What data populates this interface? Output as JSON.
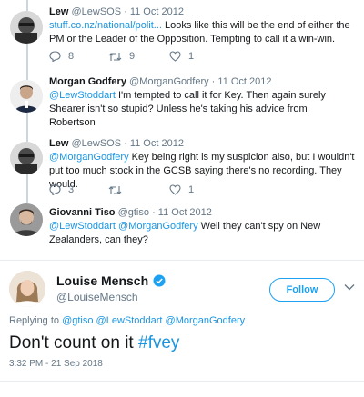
{
  "tweets": [
    {
      "name": "Lew",
      "handle": "@LewSOS",
      "date": "· 11 Oct 2012",
      "link": "stuff.co.nz/national/polit...",
      "text": " Looks like this will be the end of either the PM or the Leader of the Opposition. Tempting to call it a win-win.",
      "replies": "8",
      "retweets": "9",
      "likes": "1"
    },
    {
      "name": "Morgan Godfery",
      "handle": "@MorganGodfery",
      "date": "· 11 Oct 2012",
      "mention": "@LewStoddart",
      "text": " I'm tempted to call it for Key. Then again surely Shearer isn't so stupid? Unless he's taking his advice from Robertson"
    },
    {
      "name": "Lew",
      "handle": "@LewSOS",
      "date": "· 11 Oct 2012",
      "mention": "@MorganGodfery",
      "text": " Key being right is my suspicion also, but I wouldn't put too much stock in the GCSB saying there's no recording. They would.",
      "replies": "3",
      "retweets": "",
      "likes": "1"
    },
    {
      "name": "Giovanni Tiso",
      "handle": "@gtiso",
      "date": "· 11 Oct 2012",
      "mention1": "@LewStoddart",
      "mention2": "@MorganGodfery",
      "text": " Well they can't spy on New Zealanders, can they?"
    }
  ],
  "main_tweet": {
    "name": "Louise Mensch",
    "handle": "@LouiseMensch",
    "follow_label": "Follow",
    "replying_prefix": "Replying to ",
    "replying_to": "@gtiso @LewStoddart @MorganGodfery",
    "text": "Don't count on it ",
    "hashtag": "#fvey",
    "timestamp": "3:32 PM - 21 Sep 2018"
  },
  "colors": {
    "link": "#1b95e0",
    "verified": "#1da1f2",
    "muted": "#657786"
  },
  "icons": [
    "reply-icon",
    "retweet-icon",
    "like-icon",
    "verified-icon",
    "chevron-down-icon"
  ]
}
